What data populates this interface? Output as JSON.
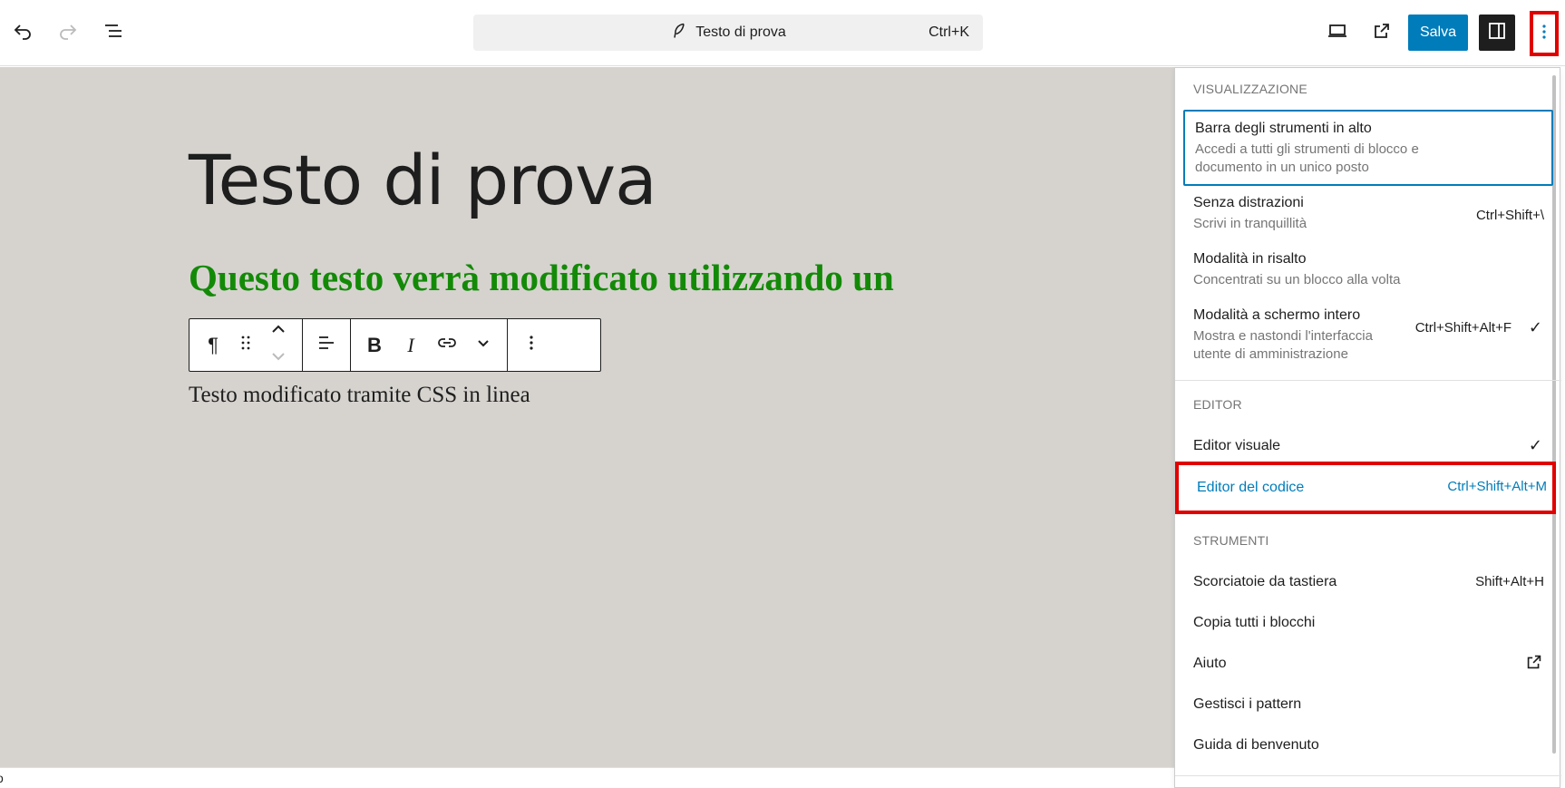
{
  "topbar": {
    "document_title": "Testo di prova",
    "command_shortcut": "Ctrl+K",
    "save_label": "Salva"
  },
  "canvas": {
    "post_title": "Testo di prova",
    "heading": "Questo testo verrà modificato utilizzando un",
    "paragraph": "Testo modificato tramite CSS in linea",
    "footer_letter": "o"
  },
  "colors": {
    "accent": "#007cba",
    "heading_green": "#138a07",
    "canvas_bg": "#d6d3cf",
    "highlight_red": "#e00000"
  },
  "menu": {
    "visualizzazione": {
      "label": "VISUALIZZAZIONE",
      "items": [
        {
          "label": "Barra degli strumenti in alto",
          "desc": "Accedi a tutti gli strumenti di blocco e documento in un unico posto",
          "shortcut": ""
        },
        {
          "label": "Senza distrazioni",
          "desc": "Scrivi in tranquillità",
          "shortcut": "Ctrl+Shift+\\"
        },
        {
          "label": "Modalità in risalto",
          "desc": "Concentrati su un blocco alla volta",
          "shortcut": ""
        },
        {
          "label": "Modalità a schermo intero",
          "desc": "Mostra e nastondi l'interfaccia utente di amministrazione",
          "shortcut": "Ctrl+Shift+Alt+F",
          "checked": true
        }
      ]
    },
    "editor": {
      "label": "EDITOR",
      "items": [
        {
          "label": "Editor visuale",
          "shortcut": "",
          "checked": true
        },
        {
          "label": "Editor del codice",
          "shortcut": "Ctrl+Shift+Alt+M"
        }
      ]
    },
    "strumenti": {
      "label": "STRUMENTI",
      "items": [
        {
          "label": "Scorciatoie da tastiera",
          "shortcut": "Shift+Alt+H"
        },
        {
          "label": "Copia tutti i blocchi",
          "shortcut": ""
        },
        {
          "label": "Aiuto",
          "shortcut": ""
        },
        {
          "label": "Gestisci i pattern",
          "shortcut": ""
        },
        {
          "label": "Guida di benvenuto",
          "shortcut": ""
        }
      ]
    }
  },
  "icons": {
    "check": "✓"
  }
}
